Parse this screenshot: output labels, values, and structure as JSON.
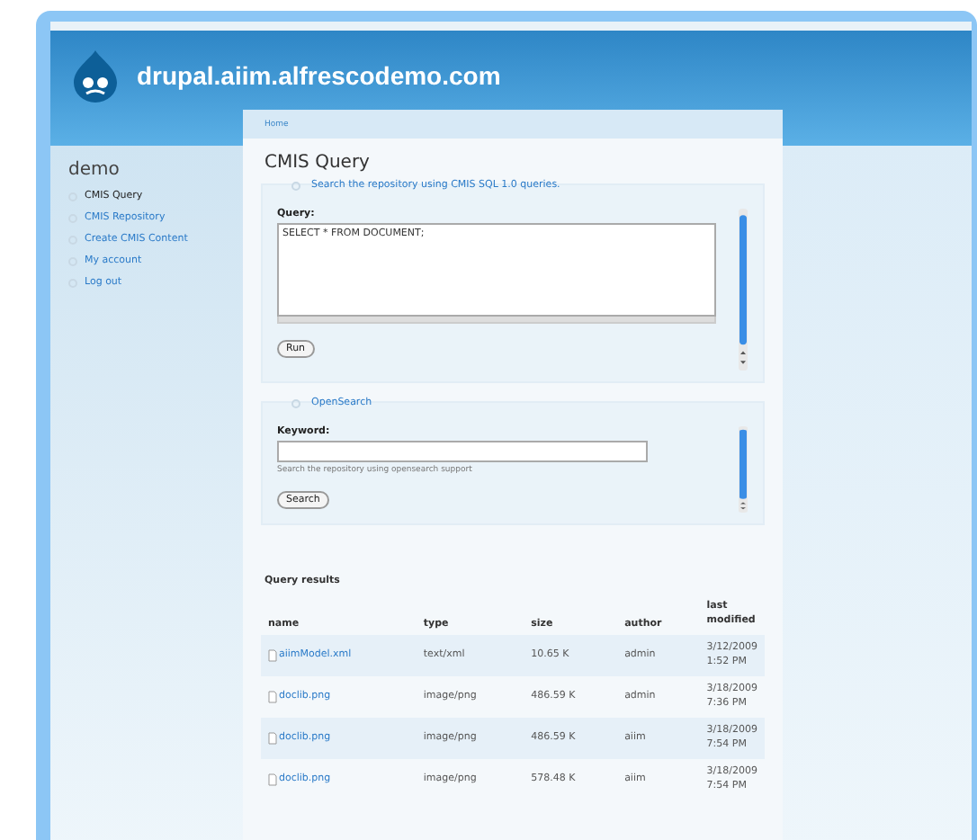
{
  "site": {
    "name": "drupal.aiim.alfrescodemo.com"
  },
  "breadcrumb": [
    "Home"
  ],
  "sidebar": {
    "title": "demo",
    "items": [
      {
        "label": "CMIS Query",
        "selected": true
      },
      {
        "label": "CMIS Repository",
        "selected": false
      },
      {
        "label": "Create CMIS Content",
        "selected": false
      },
      {
        "label": "My account",
        "selected": false
      },
      {
        "label": "Log out",
        "selected": false
      }
    ]
  },
  "page_title": "CMIS Query",
  "query_form": {
    "legend": "Search the repository using CMIS SQL 1.0 queries.",
    "label": "Query:",
    "value": "SELECT * FROM DOCUMENT;",
    "button": "Run"
  },
  "opensearch_form": {
    "legend": "OpenSearch",
    "label": "Keyword:",
    "description": "Search the repository using opensearch support",
    "button": "Search"
  },
  "results": {
    "title": "Query results",
    "columns": [
      "name",
      "type",
      "size",
      "author",
      "last modified"
    ],
    "rows": [
      {
        "name": "aiimModel.xml",
        "type": "text/xml",
        "size": "10.65 K",
        "author": "admin",
        "modified": "3/12/2009 1:52 PM"
      },
      {
        "name": "doclib.png",
        "type": "image/png",
        "size": "486.59 K",
        "author": "admin",
        "modified": "3/18/2009 7:36 PM"
      },
      {
        "name": "doclib.png",
        "type": "image/png",
        "size": "486.59 K",
        "author": "aiim",
        "modified": "3/18/2009 7:54 PM"
      },
      {
        "name": "doclib.png",
        "type": "image/png",
        "size": "578.48 K",
        "author": "aiim",
        "modified": "3/18/2009 7:54 PM"
      }
    ]
  }
}
